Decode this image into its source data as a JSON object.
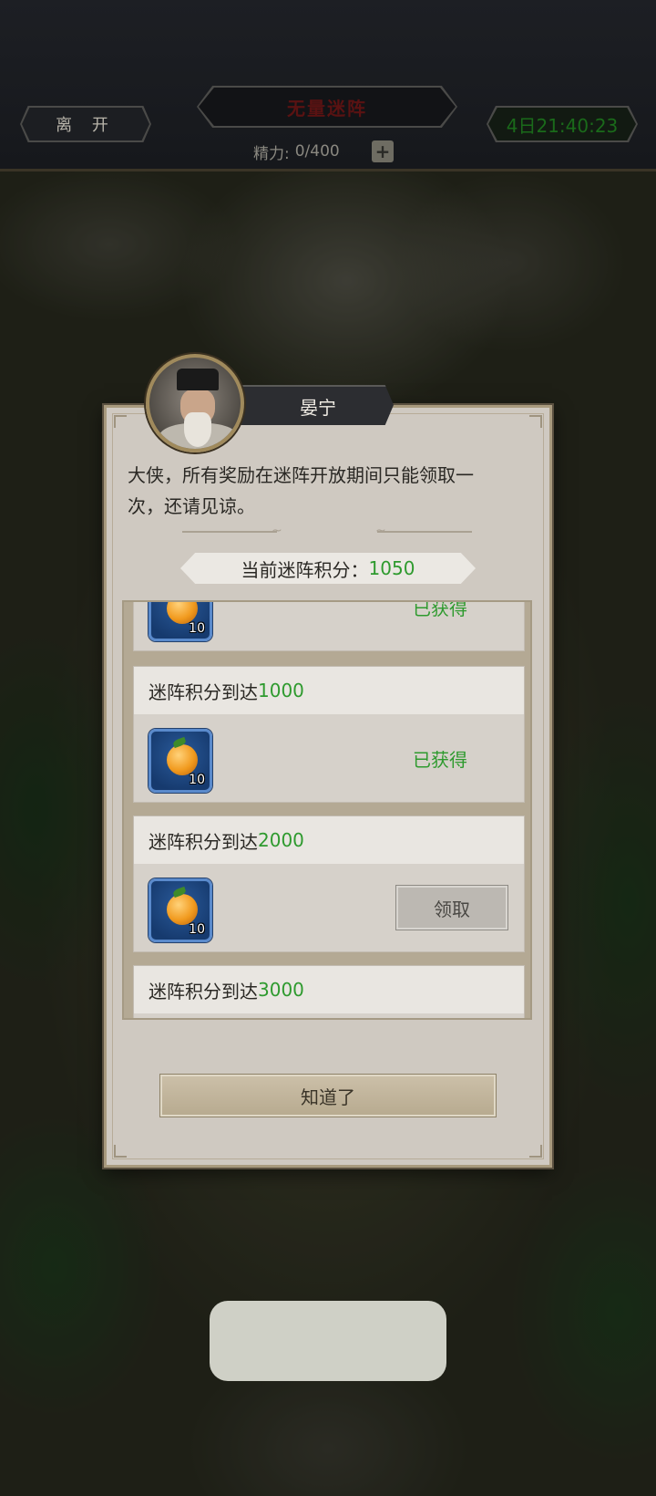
{
  "topbar": {
    "leave_label": "离 开",
    "title": "无量迷阵",
    "timer": "4日21:40:23",
    "energy_label": "精力:",
    "energy_value": "0/400",
    "plus_symbol": "+"
  },
  "npc": {
    "name": "晏宁",
    "portrait_icon": "npc-portrait-elder"
  },
  "dialog": {
    "message_line1": "大侠，所有奖励在迷阵开放期间只能领取一",
    "message_line2": "次，还请见谅。",
    "score_label": "当前迷阵积分：",
    "score_value": "1050",
    "ok_label": "知道了"
  },
  "rewards": [
    {
      "header_prefix": "",
      "header_value": "",
      "item_icon": "orange-fruit-icon",
      "qty": "10",
      "status": "已获得"
    },
    {
      "header_prefix": "迷阵积分到达",
      "header_value": "1000",
      "item_icon": "orange-fruit-icon",
      "qty": "10",
      "status": "已获得"
    },
    {
      "header_prefix": "迷阵积分到达",
      "header_value": "2000",
      "item_icon": "orange-fruit-icon",
      "qty": "10",
      "status": "领取"
    },
    {
      "header_prefix": "迷阵积分到达",
      "header_value": "3000"
    }
  ],
  "colors": {
    "accent_green": "#2e9a2e",
    "title_red": "#5a1212",
    "timer_green": "#1a6a1a"
  }
}
